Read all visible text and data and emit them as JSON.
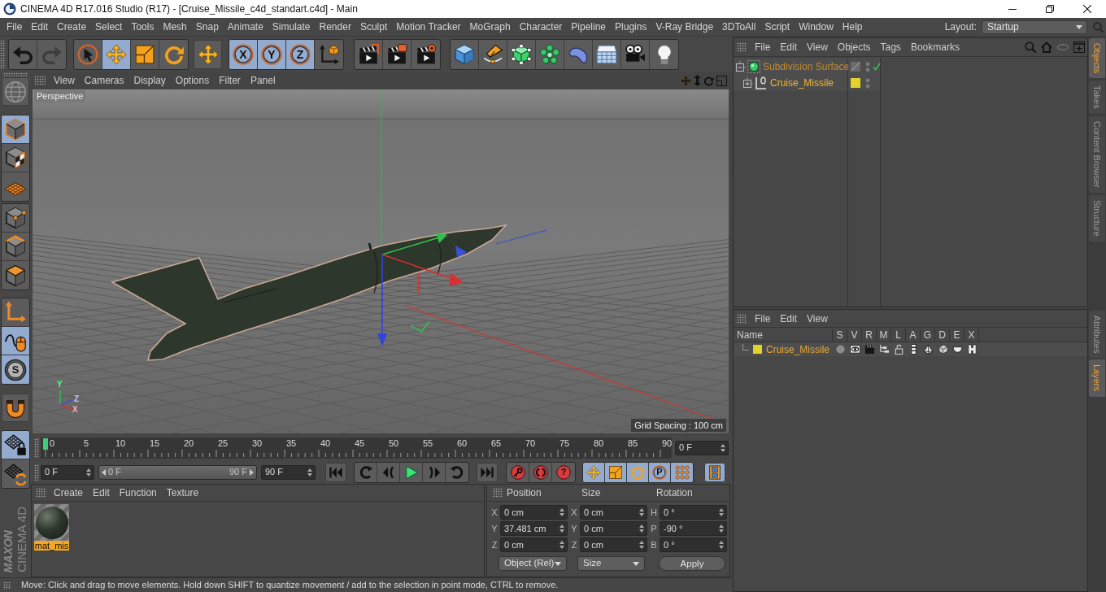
{
  "window": {
    "title": "CINEMA 4D R17.016 Studio (R17) - [Cruise_Missile_c4d_standart.c4d] - Main"
  },
  "menu_bar": [
    "File",
    "Edit",
    "Create",
    "Select",
    "Tools",
    "Mesh",
    "Snap",
    "Animate",
    "Simulate",
    "Render",
    "Sculpt",
    "Motion Tracker",
    "MoGraph",
    "Character",
    "Pipeline",
    "Plugins",
    "V-Ray Bridge",
    "3DToAll",
    "Script",
    "Window",
    "Help"
  ],
  "layout": {
    "label": "Layout:",
    "value": "Startup"
  },
  "toolbar": [
    {
      "tools": [
        {
          "kind": "undo",
          "selected": false,
          "disabled": false
        },
        {
          "kind": "redo",
          "selected": false,
          "disabled": true
        }
      ]
    },
    {
      "tools": [
        {
          "kind": "select",
          "selected": false,
          "disabled": false
        },
        {
          "kind": "move",
          "selected": true,
          "disabled": false
        },
        {
          "kind": "scale",
          "selected": false,
          "disabled": false
        },
        {
          "kind": "rotate",
          "selected": false,
          "disabled": false
        }
      ]
    },
    {
      "tools": [
        {
          "kind": "move",
          "selected": false,
          "disabled": false
        }
      ]
    },
    {
      "tools": [
        {
          "kind": "axis",
          "label": "X",
          "selected": true,
          "disabled": false
        },
        {
          "kind": "axis",
          "label": "Y",
          "selected": true,
          "disabled": false
        },
        {
          "kind": "axis",
          "label": "Z",
          "selected": true,
          "disabled": false
        },
        {
          "kind": "coords",
          "selected": false,
          "disabled": false
        }
      ]
    },
    {
      "tools": [
        {
          "kind": "renderview",
          "selected": false,
          "disabled": false
        },
        {
          "kind": "renderpv",
          "selected": false,
          "disabled": false
        },
        {
          "kind": "rendersettings",
          "selected": false,
          "disabled": false
        }
      ]
    },
    {
      "tools": [
        {
          "kind": "cube",
          "selected": false,
          "disabled": false
        },
        {
          "kind": "pen",
          "selected": false,
          "disabled": false
        },
        {
          "kind": "subdiv",
          "selected": false,
          "disabled": false
        },
        {
          "kind": "cloner",
          "selected": false,
          "disabled": false
        },
        {
          "kind": "deformer",
          "selected": false,
          "disabled": false
        },
        {
          "kind": "floor",
          "selected": false,
          "disabled": false
        },
        {
          "kind": "camera",
          "selected": false,
          "disabled": false
        },
        {
          "kind": "light",
          "selected": false,
          "disabled": false
        }
      ]
    }
  ],
  "mode_tools": [
    {
      "tools": [
        {
          "kind": "editable",
          "selected": false
        }
      ]
    },
    {
      "tools": [
        {
          "kind": "model",
          "selected": true
        },
        {
          "kind": "texture",
          "selected": false
        },
        {
          "kind": "workplane",
          "selected": false
        }
      ]
    },
    {
      "tools": [
        {
          "kind": "points",
          "selected": false
        },
        {
          "kind": "edges",
          "selected": false
        },
        {
          "kind": "polygons",
          "selected": false
        }
      ]
    },
    {
      "tools": [
        {
          "kind": "axismode",
          "selected": false
        },
        {
          "kind": "tweak",
          "selected": true
        },
        {
          "kind": "snap",
          "label": "S",
          "selected": true
        }
      ]
    },
    {
      "tools": [
        {
          "kind": "magnet",
          "selected": false
        }
      ]
    },
    {
      "tools": [
        {
          "kind": "gridlock",
          "selected": true
        },
        {
          "kind": "gridrotate",
          "selected": false
        }
      ]
    }
  ],
  "logo": {
    "brand": "MAXON",
    "product": "CINEMA 4D"
  },
  "viewport": {
    "menu": [
      "View",
      "Cameras",
      "Display",
      "Options",
      "Filter",
      "Panel"
    ],
    "camera": "Perspective",
    "grid_spacing": "Grid Spacing : 100 cm",
    "axis_labels": [
      "Y",
      "Z",
      "X"
    ]
  },
  "timeline": {
    "frames": [
      "0",
      "5",
      "10",
      "15",
      "20",
      "25",
      "30",
      "35",
      "40",
      "45",
      "50",
      "55",
      "60",
      "65",
      "70",
      "75",
      "80",
      "85",
      "90"
    ],
    "level": 0,
    "current": "0 F"
  },
  "transport": {
    "start": "0 F",
    "range": {
      "start": "0 F",
      "end": "90 F",
      "level": 1
    },
    "end": "90 F",
    "buttons": [
      {
        "tools": [
          {
            "kind": "start",
            "selected": false
          }
        ]
      },
      {
        "tools": [
          {
            "kind": "prevkey",
            "selected": false
          },
          {
            "kind": "prevframe",
            "selected": false
          },
          {
            "kind": "play",
            "selected": false
          },
          {
            "kind": "nextframe",
            "selected": false
          },
          {
            "kind": "nextkey",
            "selected": false
          }
        ]
      },
      {
        "tools": [
          {
            "kind": "end",
            "selected": false
          }
        ]
      },
      {
        "tools": [
          {
            "kind": "record",
            "selected": false
          },
          {
            "kind": "autokey",
            "selected": false
          },
          {
            "kind": "keysel",
            "label": "?",
            "selected": false
          }
        ]
      },
      {
        "tools": [
          {
            "kind": "keymove",
            "selected": true
          },
          {
            "kind": "keyscale",
            "selected": true
          },
          {
            "kind": "keyrot",
            "selected": true
          },
          {
            "kind": "keyparam",
            "label": "P",
            "selected": true
          },
          {
            "kind": "keypla",
            "selected": true
          }
        ]
      },
      {
        "tools": [
          {
            "kind": "timeline",
            "selected": true
          }
        ]
      }
    ]
  },
  "materials": {
    "menu": [
      "Create",
      "Edit",
      "Function",
      "Texture"
    ],
    "items": [
      {
        "name": "mat_mis",
        "selected": true
      }
    ]
  },
  "coordinates": {
    "headers": [
      "Position",
      "Size",
      "Rotation"
    ],
    "rows": [
      {
        "axes": [
          "X",
          "X",
          "H"
        ],
        "values": [
          "0 cm",
          "0 cm",
          "0 °"
        ]
      },
      {
        "axes": [
          "Y",
          "Y",
          "P"
        ],
        "values": [
          "37.481 cm",
          "0 cm",
          "-90 °"
        ]
      },
      {
        "axes": [
          "Z",
          "Z",
          "B"
        ],
        "values": [
          "0 cm",
          "0 cm",
          "0 °"
        ]
      }
    ],
    "mode": "Object (Rel)",
    "size_mode": "Size",
    "apply": "Apply"
  },
  "status_bar": {
    "text": "Move: Click and drag to move elements. Hold down SHIFT to quantize movement / add to the selection in point mode, CTRL to remove."
  },
  "object_manager": {
    "menu": [
      "File",
      "Edit",
      "View",
      "Objects",
      "Tags",
      "Bookmarks"
    ],
    "objects": [
      {
        "name": "Subdivision Surface",
        "kind": "subdivision",
        "color": "#c68a2e",
        "expanded": true,
        "checked": true,
        "children": [
          {
            "name": "Cruise_Missile",
            "kind": "polygon",
            "color": "#f2b634",
            "expanded": false,
            "checked": false,
            "layer": {
              "color": "#e3d22c"
            }
          }
        ]
      }
    ]
  },
  "layer_manager": {
    "menu": [
      "File",
      "Edit",
      "View"
    ],
    "columns": [
      "Name",
      "S",
      "V",
      "R",
      "M",
      "L",
      "A",
      "G",
      "D",
      "E",
      "X"
    ],
    "layers": [
      {
        "name": "Cruise_Missile",
        "color": "#e3d22c"
      }
    ]
  },
  "side_tabs": {
    "upper": [
      {
        "label": "Objects",
        "selected": true
      },
      {
        "label": "Takes",
        "selected": false
      },
      {
        "label": "Content Browser",
        "selected": false
      },
      {
        "label": "Structure",
        "selected": false
      }
    ],
    "lower": [
      {
        "label": "Attributes",
        "selected": false
      },
      {
        "label": "Layers",
        "selected": true
      }
    ]
  }
}
